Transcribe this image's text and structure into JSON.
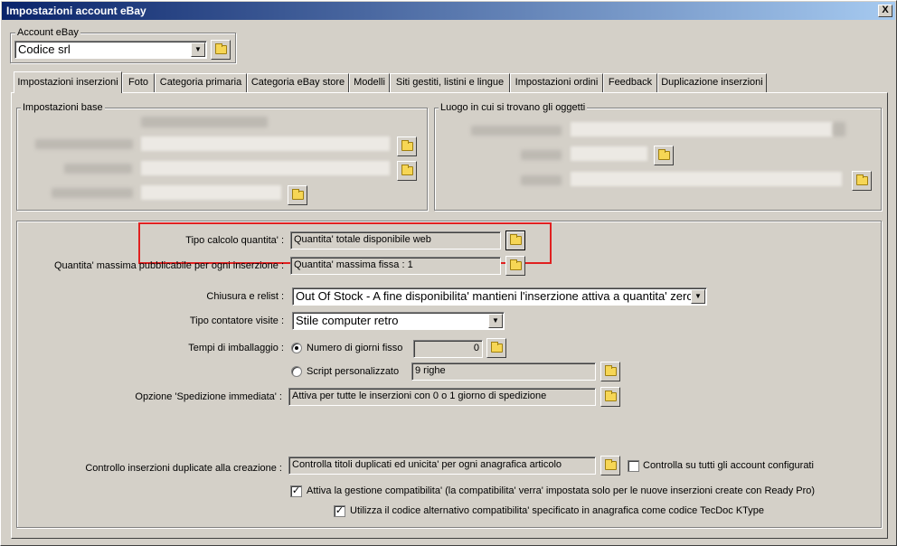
{
  "window": {
    "title": "Impostazioni account eBay",
    "close_label": "X"
  },
  "account": {
    "group_label": "Account eBay",
    "value": "Codice srl"
  },
  "tabs": [
    {
      "label": "Impostazioni inserzioni"
    },
    {
      "label": "Foto"
    },
    {
      "label": "Categoria primaria"
    },
    {
      "label": "Categoria eBay store"
    },
    {
      "label": "Modelli"
    },
    {
      "label": "Siti gestiti, listini e lingue"
    },
    {
      "label": "Impostazioni ordini"
    },
    {
      "label": "Feedback"
    },
    {
      "label": "Duplicazione inserzioni"
    }
  ],
  "groups": {
    "base": "Impostazioni base",
    "location": "Luogo in cui si trovano gli oggetti"
  },
  "form": {
    "qty_calc": {
      "label": "Tipo calcolo quantita' :",
      "value": "Quantita' totale disponibile web"
    },
    "max_qty": {
      "label": "Quantita' massima pubblicabile per ogni inserzione :",
      "value": "Quantita' massima fissa : 1"
    },
    "close_relist": {
      "label": "Chiusura e relist :",
      "value": "Out Of Stock - A fine disponibilita' mantieni l'inserzione attiva a quantita' zero"
    },
    "counter": {
      "label": "Tipo contatore visite :",
      "value": "Stile computer retro"
    },
    "packaging": {
      "label": "Tempi di imballaggio :",
      "opt_fixed": "Numero di giorni fisso",
      "fixed_value": "0",
      "opt_script": "Script personalizzato",
      "script_value": "9 righe"
    },
    "fast_ship": {
      "label": "Opzione 'Spedizione immediata' :",
      "value": "Attiva per tutte le inserzioni con 0 o 1 giorno di spedizione"
    },
    "dup_check": {
      "label": "Controllo inserzioni duplicate alla creazione :",
      "value": "Controlla titoli duplicati ed unicita' per ogni anagrafica articolo",
      "all_accounts_label": "Controlla su tutti gli account configurati",
      "all_accounts_checked": false
    },
    "compat": {
      "label": "Attiva la gestione compatibilita'  (la compatibilita' verra' impostata solo per le nuove inserzioni create con Ready Pro)",
      "checked": true
    },
    "tecdoc": {
      "label": "Utilizza il codice alternativo compatibilita' specificato in anagrafica come codice TecDoc KType",
      "checked": true
    }
  }
}
